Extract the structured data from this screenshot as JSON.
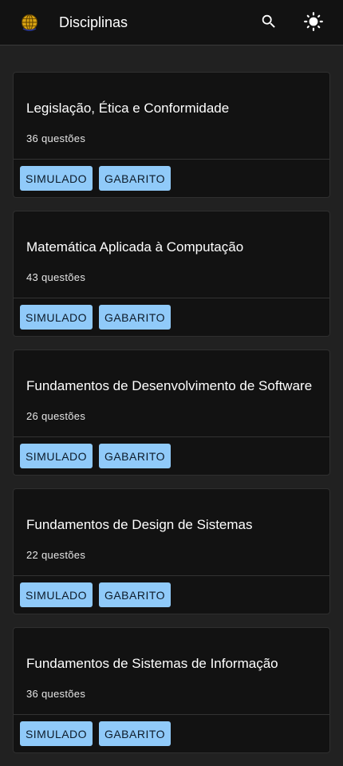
{
  "header": {
    "title": "Disciplinas",
    "logo_icon": "globe-logo-icon",
    "search_icon": "search-icon",
    "theme_icon": "sun-icon"
  },
  "colors": {
    "background": "#212121",
    "card": "#121212",
    "button": "#90caf9"
  },
  "disciplines": [
    {
      "title": "Legislação, Ética e Conformidade",
      "count": "36 questões",
      "simulado": "SIMULADO",
      "gabarito": "GABARITO"
    },
    {
      "title": "Matemática Aplicada à Computação",
      "count": "43 questões",
      "simulado": "SIMULADO",
      "gabarito": "GABARITO"
    },
    {
      "title": "Fundamentos de Desenvolvimento de Software",
      "count": "26 questões",
      "simulado": "SIMULADO",
      "gabarito": "GABARITO"
    },
    {
      "title": "Fundamentos de Design de Sistemas",
      "count": "22 questões",
      "simulado": "SIMULADO",
      "gabarito": "GABARITO"
    },
    {
      "title": "Fundamentos de Sistemas de Informação",
      "count": "36 questões",
      "simulado": "SIMULADO",
      "gabarito": "GABARITO"
    }
  ]
}
